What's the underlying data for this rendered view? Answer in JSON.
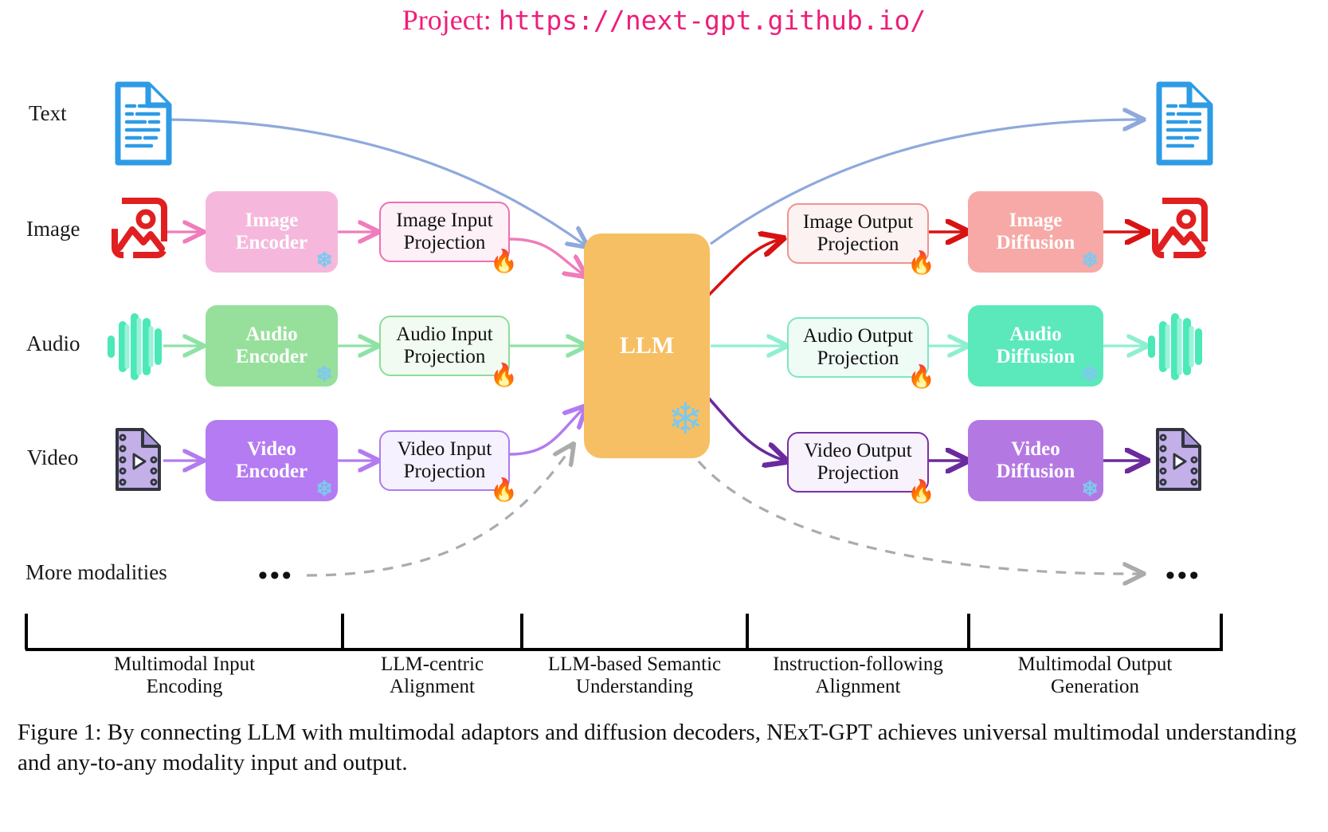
{
  "title": {
    "label": "Project:",
    "url": "https://next-gpt.github.io/",
    "color": "#ED1E79"
  },
  "modalities": [
    {
      "name": "text",
      "label": "Text",
      "icon": "text-document-icon",
      "color": "#2E9BE6"
    },
    {
      "name": "image",
      "label": "Image",
      "icon": "image-picture-icon",
      "color": "#E02020"
    },
    {
      "name": "audio",
      "label": "Audio",
      "icon": "audio-waveform-icon",
      "color": "#4BE8B8"
    },
    {
      "name": "video",
      "label": "Video",
      "icon": "video-film-icon",
      "color": "#B69BE0"
    },
    {
      "name": "more",
      "label": "More modalities",
      "icon": "ellipsis-icon",
      "color": "#A8A8A8"
    }
  ],
  "encoders": [
    {
      "name": "image-encoder",
      "l1": "Image",
      "l2": "Encoder",
      "fill": "#F5B8DC",
      "badge": "snowflake"
    },
    {
      "name": "audio-encoder",
      "l1": "Audio",
      "l2": "Encoder",
      "fill": "#96E09B",
      "badge": "snowflake"
    },
    {
      "name": "video-encoder",
      "l1": "Video",
      "l2": "Encoder",
      "fill": "#B57BF2",
      "badge": "snowflake"
    }
  ],
  "input_projections": [
    {
      "name": "image-input-projection",
      "l1": "Image Input",
      "l2": "Projection",
      "fill": "#FDF0F7",
      "border": "#EE6FB4",
      "badge": "fire"
    },
    {
      "name": "audio-input-projection",
      "l1": "Audio Input",
      "l2": "Projection",
      "fill": "#F1FBF1",
      "border": "#8FDC97",
      "badge": "fire"
    },
    {
      "name": "video-input-projection",
      "l1": "Video Input",
      "l2": "Projection",
      "fill": "#F6F1FE",
      "border": "#AF7BF0",
      "badge": "fire"
    }
  ],
  "llm": {
    "name": "llm-core",
    "label": "LLM",
    "fill": "#F7BF63",
    "badge": "snowflake"
  },
  "output_projections": [
    {
      "name": "image-output-projection",
      "l1": "Image Output",
      "l2": "Projection",
      "fill": "#FDF2F2",
      "border": "#F0928F",
      "badge": "fire"
    },
    {
      "name": "audio-output-projection",
      "l1": "Audio Output",
      "l2": "Projection",
      "fill": "#EFFCF6",
      "border": "#7FE6C3",
      "badge": "fire"
    },
    {
      "name": "video-output-projection",
      "l1": "Video Output",
      "l2": "Projection",
      "fill": "#F7F2FC",
      "border": "#7B2FA8",
      "badge": "fire"
    }
  ],
  "diffusions": [
    {
      "name": "image-diffusion",
      "l1": "Image",
      "l2": "Diffusion",
      "fill": "#F6A9A6",
      "badge": "snowflake"
    },
    {
      "name": "audio-diffusion",
      "l1": "Audio",
      "l2": "Diffusion",
      "fill": "#5BE9BC",
      "badge": "snowflake"
    },
    {
      "name": "video-diffusion",
      "l1": "Video",
      "l2": "Diffusion",
      "fill": "#B478E3",
      "badge": "snowflake"
    }
  ],
  "more_dots": {
    "left": "•••",
    "right": "•••"
  },
  "stages": [
    {
      "name": "stage-multimodal-input-encoding",
      "l1": "Multimodal Input",
      "l2": "Encoding"
    },
    {
      "name": "stage-llm-centric-alignment",
      "l1": "LLM-centric",
      "l2": "Alignment"
    },
    {
      "name": "stage-llm-based-semantic-understanding",
      "l1": "LLM-based Semantic",
      "l2": "Understanding"
    },
    {
      "name": "stage-instruction-following-alignment",
      "l1": "Instruction-following",
      "l2": "Alignment"
    },
    {
      "name": "stage-multimodal-output-generation",
      "l1": "Multimodal Output",
      "l2": "Generation"
    }
  ],
  "caption": "Figure 1: By connecting LLM with multimodal adaptors and diffusion decoders, NExT-GPT achieves universal multimodal understanding and any-to-any modality input and output.",
  "arrow_colors": {
    "text": "#8FA9DC",
    "image_in": "#F07CBB",
    "image_out": "#D81212",
    "audio": "#8FE2A6",
    "audio_out": "#8FEFD0",
    "video_in": "#B27BF0",
    "video_out": "#6B2A9E",
    "dashed": "#ABABAB"
  }
}
